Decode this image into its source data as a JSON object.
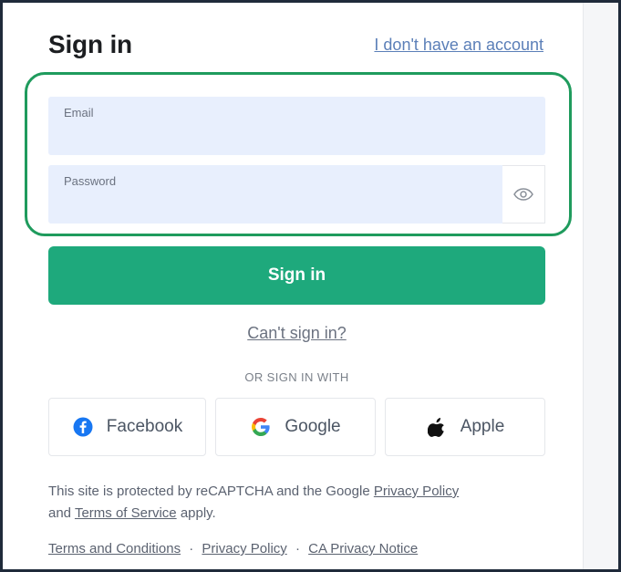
{
  "header": {
    "title": "Sign in",
    "no_account_link": "I don't have an account"
  },
  "form": {
    "email": {
      "label": "Email",
      "value": ""
    },
    "password": {
      "label": "Password",
      "value": ""
    },
    "show_password_icon": "eye-icon",
    "submit_label": "Sign in",
    "cant_sign_in": "Can't sign in?"
  },
  "social": {
    "divider_label": "OR SIGN IN WITH",
    "providers": [
      {
        "label": "Facebook",
        "icon": "facebook-icon",
        "color": "#1877f2"
      },
      {
        "label": "Google",
        "icon": "google-icon",
        "color": "#4285f4"
      },
      {
        "label": "Apple",
        "icon": "apple-icon",
        "color": "#111111"
      }
    ]
  },
  "legal": {
    "recaptcha_prefix": "This site is protected by reCAPTCHA and the Google",
    "privacy_policy": "Privacy Policy",
    "and": "and",
    "terms_of_service": "Terms of Service",
    "apply": "apply."
  },
  "footer": {
    "links": [
      "Terms and Conditions",
      "Privacy Policy",
      "CA Privacy Notice"
    ],
    "separator": "·"
  },
  "colors": {
    "accent": "#1ea97c",
    "highlight_border": "#1f9b5d",
    "field_bg": "#e8effd",
    "link": "#5b7fb8"
  }
}
